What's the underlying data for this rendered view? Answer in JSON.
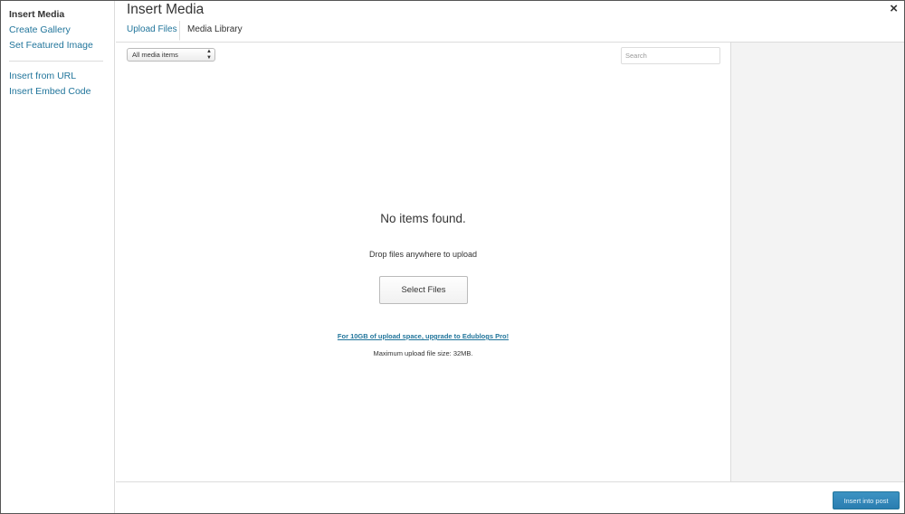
{
  "sidebar": {
    "items": [
      {
        "label": "Insert Media"
      },
      {
        "label": "Create Gallery"
      },
      {
        "label": "Set Featured Image"
      },
      {
        "label": "Insert from URL"
      },
      {
        "label": "Insert Embed Code"
      }
    ]
  },
  "header": {
    "title": "Insert Media",
    "close_glyph": "×"
  },
  "tabs": [
    {
      "label": "Upload Files"
    },
    {
      "label": "Media Library"
    }
  ],
  "toolbar": {
    "filter_value": "All media items",
    "search_placeholder": "Search"
  },
  "main": {
    "empty_message": "No items found.",
    "drop_text": "Drop files anywhere to upload",
    "select_files_label": "Select Files",
    "upgrade_link": "For 10GB of upload space, upgrade to Edublogs Pro!",
    "max_upload": "Maximum upload file size: 32MB."
  },
  "footer": {
    "insert_label": "Insert into post"
  },
  "colors": {
    "link": "#21759b",
    "primary_button": "#2a7db0",
    "side_panel": "#f3f3f3"
  }
}
